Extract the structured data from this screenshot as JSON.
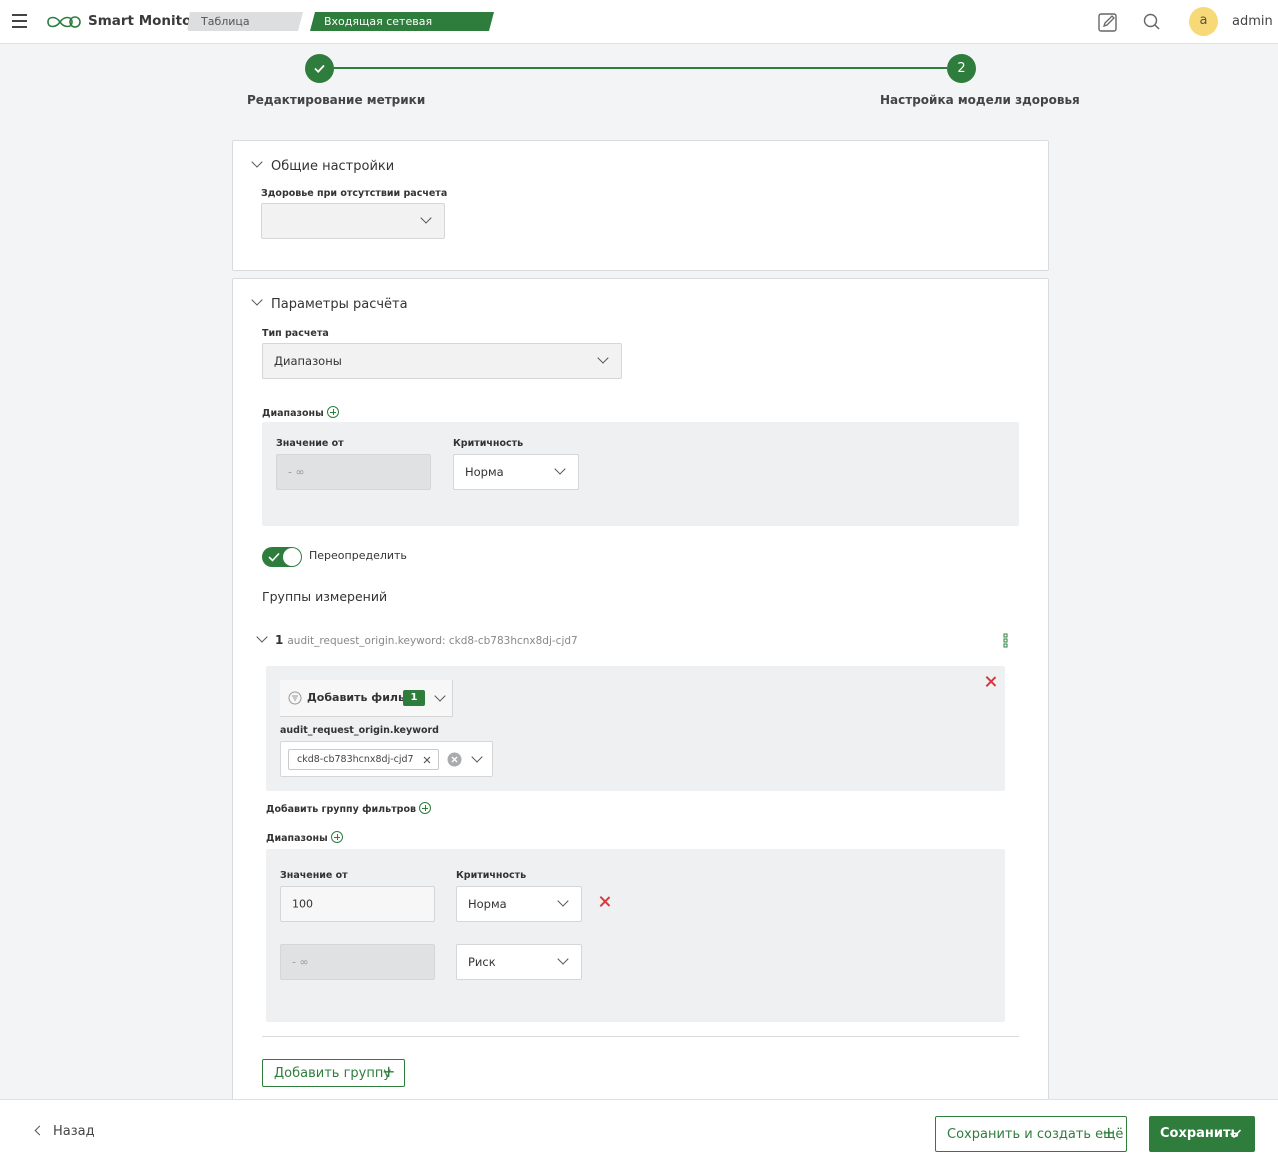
{
  "header": {
    "app_name": "Smart Monitor",
    "breadcrumbs": [
      "Таблица метрик",
      "Входящая сетевая нагрузка"
    ],
    "avatar_letter": "a",
    "user_name": "admin"
  },
  "stepper": {
    "steps": [
      {
        "label": "Редактирование метрики",
        "state": "done"
      },
      {
        "label": "Настройка модели здоровья",
        "number": "2",
        "state": "active"
      }
    ]
  },
  "general": {
    "title": "Общие настройки",
    "health_label": "Здоровье при отсутствии расчета",
    "health_value": ""
  },
  "calc": {
    "title": "Параметры расчёта",
    "type_label": "Тип расчета",
    "type_value": "Диапазоны",
    "ranges_label": "Диапазоны",
    "value_from_label": "Значение от",
    "severity_label": "Критичность",
    "range_from": "- ∞",
    "range_severity": "Норма",
    "override_label": "Переопределить",
    "override_on": true,
    "groups_title": "Группы измерений",
    "group": {
      "number": "1",
      "summary": "audit_request_origin.keyword: ckd8-cb783hcnx8dj-cjd7",
      "add_filter_label": "Добавить фильтр",
      "filter_count": "1",
      "field_label": "audit_request_origin.keyword",
      "tag_value": "ckd8-cb783hcnx8dj-cjd7",
      "add_filter_group_label": "Добавить группу фильтров",
      "ranges_label": "Диапазоны",
      "value_from_label": "Значение от",
      "severity_label": "Критичность",
      "rows": [
        {
          "from": "100",
          "severity": "Норма"
        },
        {
          "from": "- ∞",
          "severity": "Риск"
        }
      ]
    },
    "add_group_label": "Добавить группу"
  },
  "footer": {
    "back_label": "Назад",
    "save_and_create_label": "Сохранить и создать ещё",
    "save_label": "Сохранить"
  },
  "colors": {
    "accent": "#2f7d3d",
    "danger": "#d9363e",
    "avatar": "#f7d978"
  }
}
